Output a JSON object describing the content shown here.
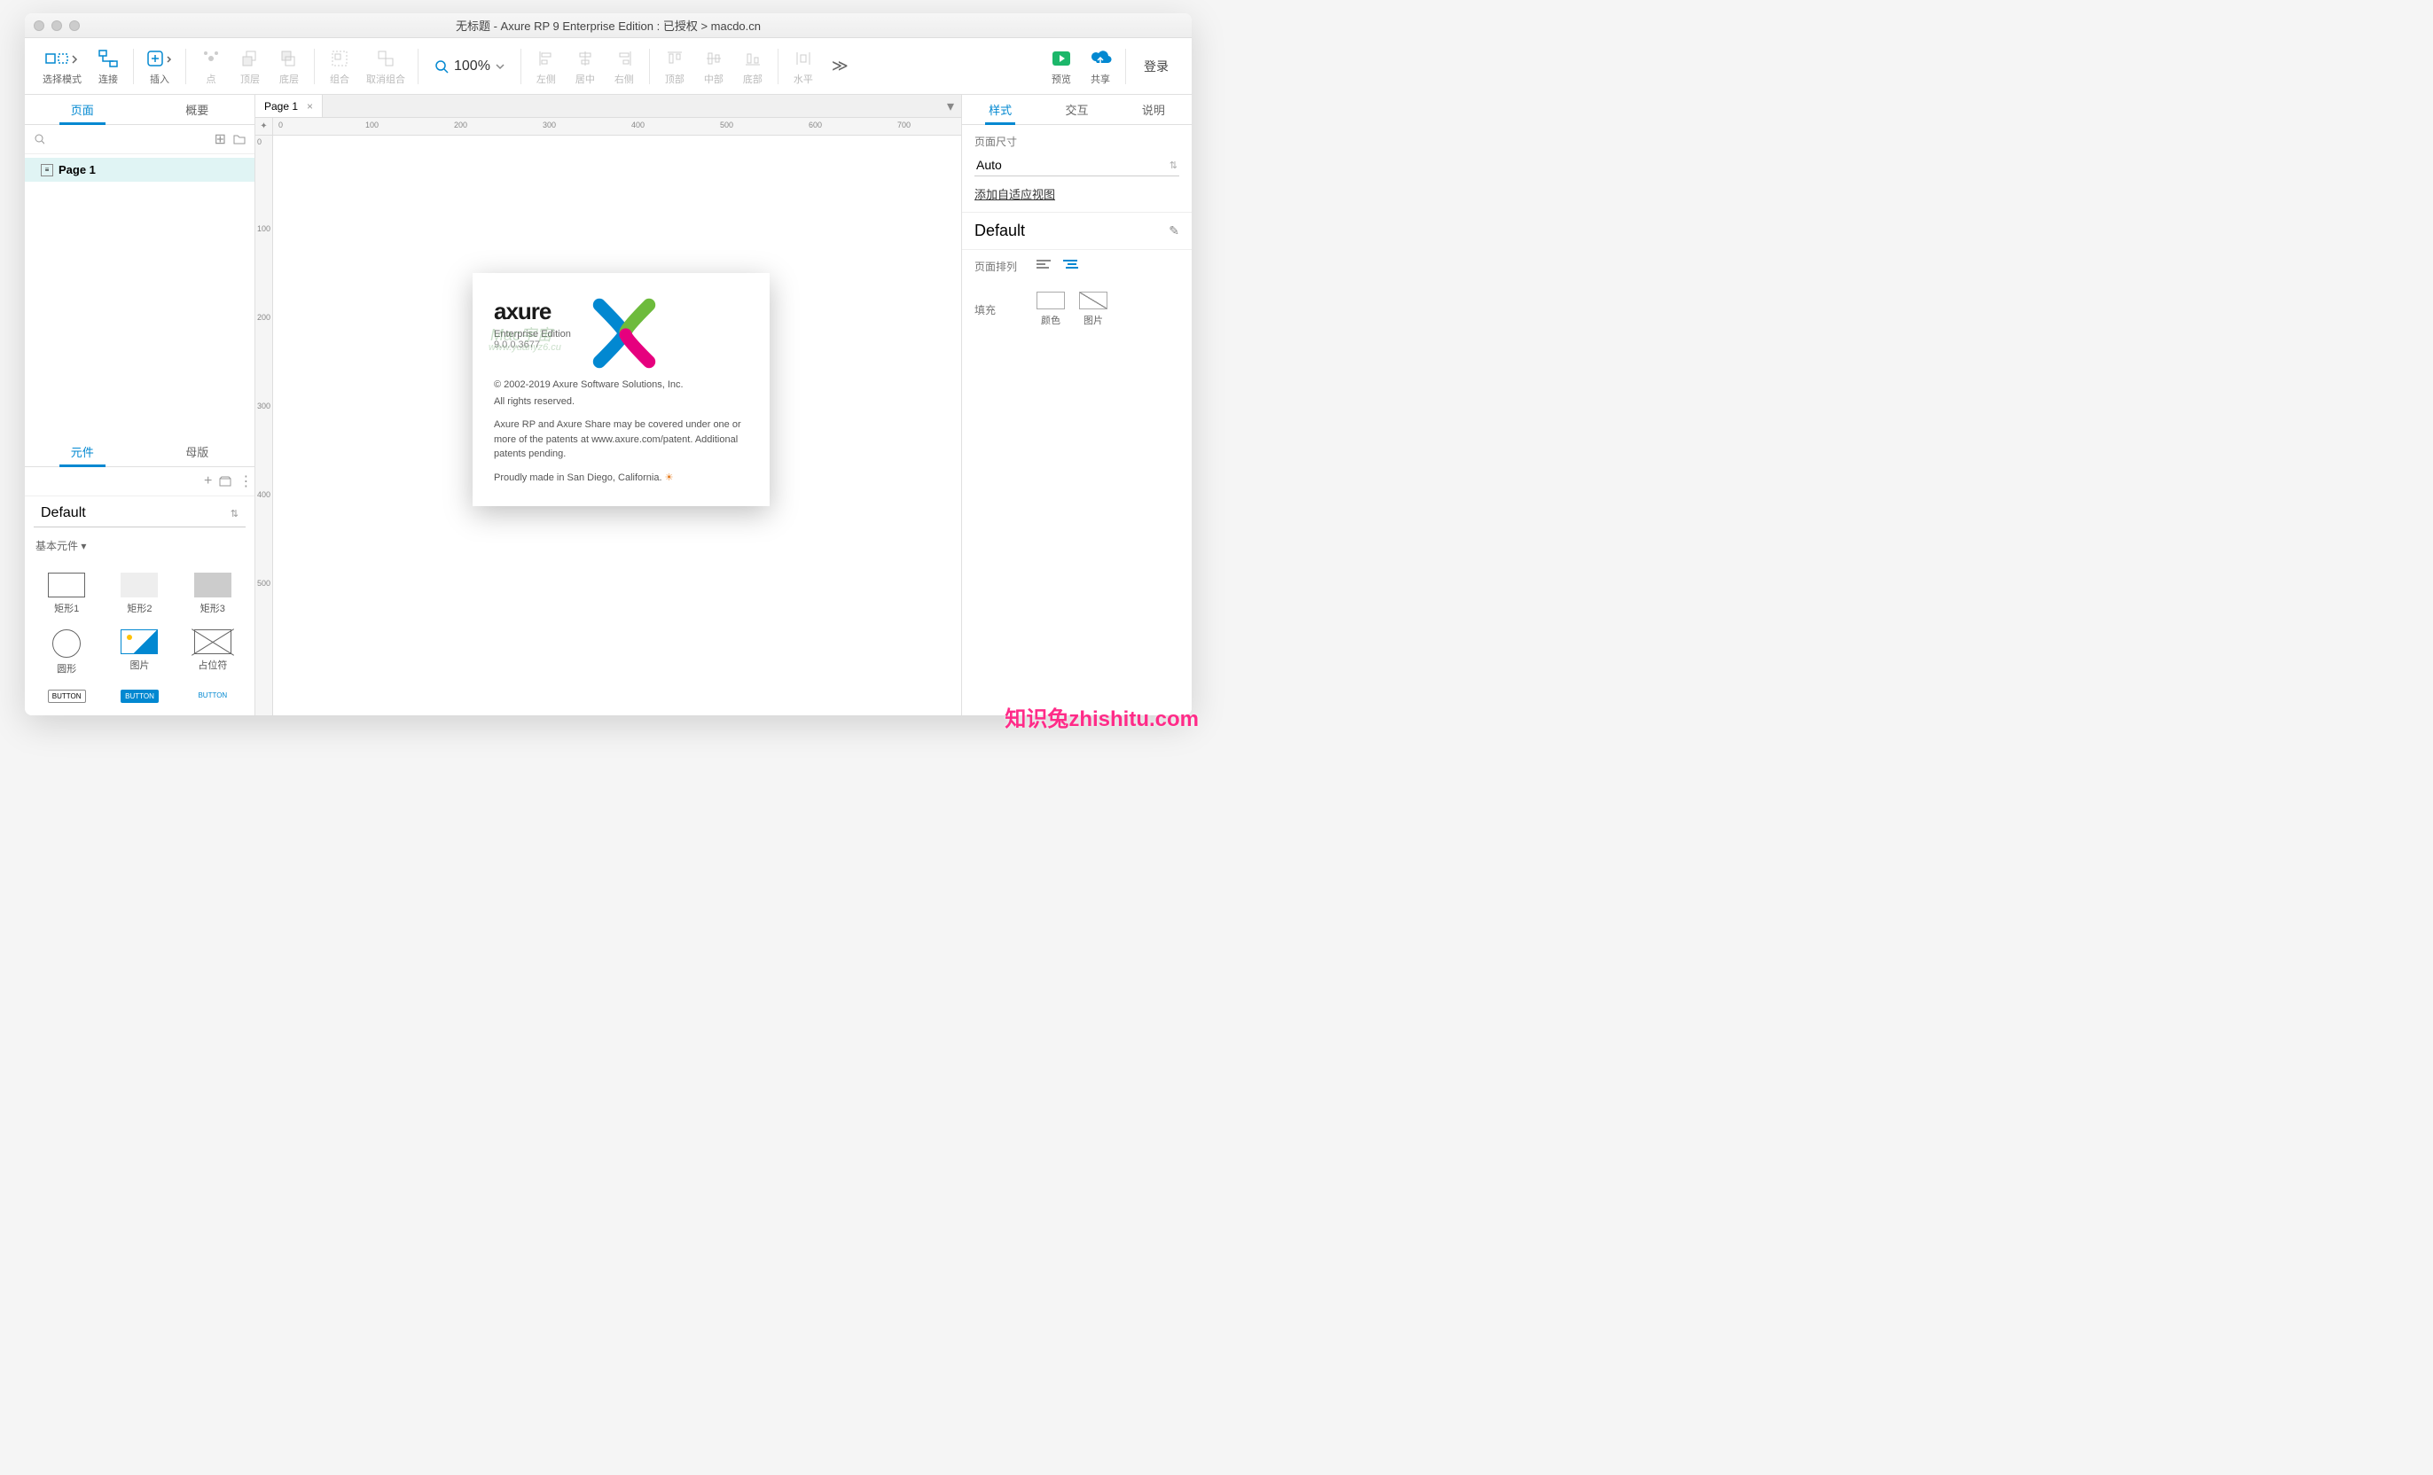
{
  "title": "无标题 - Axure RP 9 Enterprise Edition : 已授权 > macdo.cn",
  "toolbar": {
    "select_mode": "选择模式",
    "connect": "连接",
    "insert": "插入",
    "point": "点",
    "top_layer": "顶层",
    "bottom_layer": "底层",
    "group": "组合",
    "ungroup": "取消组合",
    "zoom": "100%",
    "align_left": "左侧",
    "align_center": "居中",
    "align_right": "右侧",
    "align_top": "顶部",
    "align_middle": "中部",
    "align_bottom": "底部",
    "dist_h": "水平",
    "preview": "预览",
    "share": "共享",
    "login": "登录"
  },
  "left": {
    "tab_pages": "页面",
    "tab_outline": "概要",
    "page1": "Page 1",
    "tab_widgets": "元件",
    "tab_masters": "母版",
    "lib_default": "Default",
    "section_basic": "基本元件",
    "widgets": {
      "rect1": "矩形1",
      "rect2": "矩形2",
      "rect3": "矩形3",
      "circle": "圆形",
      "image": "图片",
      "placeholder": "占位符",
      "button": "BUTTON"
    }
  },
  "canvas": {
    "page_tab": "Page 1",
    "ruler_h": [
      "0",
      "100",
      "200",
      "300",
      "400",
      "500",
      "600",
      "700"
    ],
    "ruler_v": [
      "0",
      "100",
      "200",
      "300",
      "400",
      "500"
    ]
  },
  "about": {
    "logo": "axure",
    "edition": "Enterprise Edition",
    "version": "9.0.0.3677",
    "wm1": "Mac宇宙",
    "wm2": "www.yuanyz6.cu",
    "copyright": "© 2002-2019 Axure Software Solutions, Inc.",
    "rights": "All rights reserved.",
    "patents": "Axure RP and Axure Share may be covered under one or more of the patents at www.axure.com/patent. Additional patents pending.",
    "made": "Proudly made in San Diego, California."
  },
  "right": {
    "tab_style": "样式",
    "tab_interact": "交互",
    "tab_notes": "说明",
    "page_size_label": "页面尺寸",
    "page_size_value": "Auto",
    "add_adaptive": "添加自适应视图",
    "default": "Default",
    "page_align": "页面排列",
    "fill": "填充",
    "color": "颜色",
    "image": "图片"
  },
  "watermark": "知识兔zhishitu.com"
}
